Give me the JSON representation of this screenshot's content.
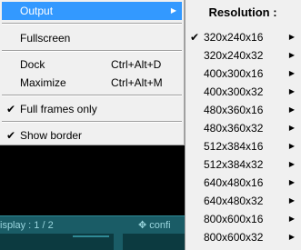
{
  "menu": {
    "items": [
      {
        "label": "Output",
        "shortcut": "",
        "checked": false,
        "submenu": true,
        "selected": true
      },
      {
        "label": "Fullscreen",
        "shortcut": "",
        "checked": false,
        "submenu": false,
        "selected": false
      },
      {
        "label": "Dock",
        "shortcut": "Ctrl+Alt+D",
        "checked": false,
        "submenu": false,
        "selected": false
      },
      {
        "label": "Maximize",
        "shortcut": "Ctrl+Alt+M",
        "checked": false,
        "submenu": false,
        "selected": false
      },
      {
        "label": "Full frames only",
        "shortcut": "",
        "checked": true,
        "submenu": false,
        "selected": false
      },
      {
        "label": "Show border",
        "shortcut": "",
        "checked": true,
        "submenu": false,
        "selected": false
      }
    ],
    "arrow_glyph": "▶",
    "check_glyph": "✔"
  },
  "submenu": {
    "header": "Resolution :",
    "items": [
      {
        "label": "320x240x16",
        "checked": true
      },
      {
        "label": "320x240x32",
        "checked": false
      },
      {
        "label": "400x300x16",
        "checked": false
      },
      {
        "label": "400x300x32",
        "checked": false
      },
      {
        "label": "480x360x16",
        "checked": false
      },
      {
        "label": "480x360x32",
        "checked": false
      },
      {
        "label": "512x384x16",
        "checked": false
      },
      {
        "label": "512x384x32",
        "checked": false
      },
      {
        "label": "640x480x16",
        "checked": false
      },
      {
        "label": "640x480x32",
        "checked": false
      },
      {
        "label": "800x600x16",
        "checked": false
      },
      {
        "label": "800x600x32",
        "checked": false
      }
    ]
  },
  "statusbar": {
    "left_text": "isplay : 1 / 2",
    "right_text": "✥ confi"
  }
}
